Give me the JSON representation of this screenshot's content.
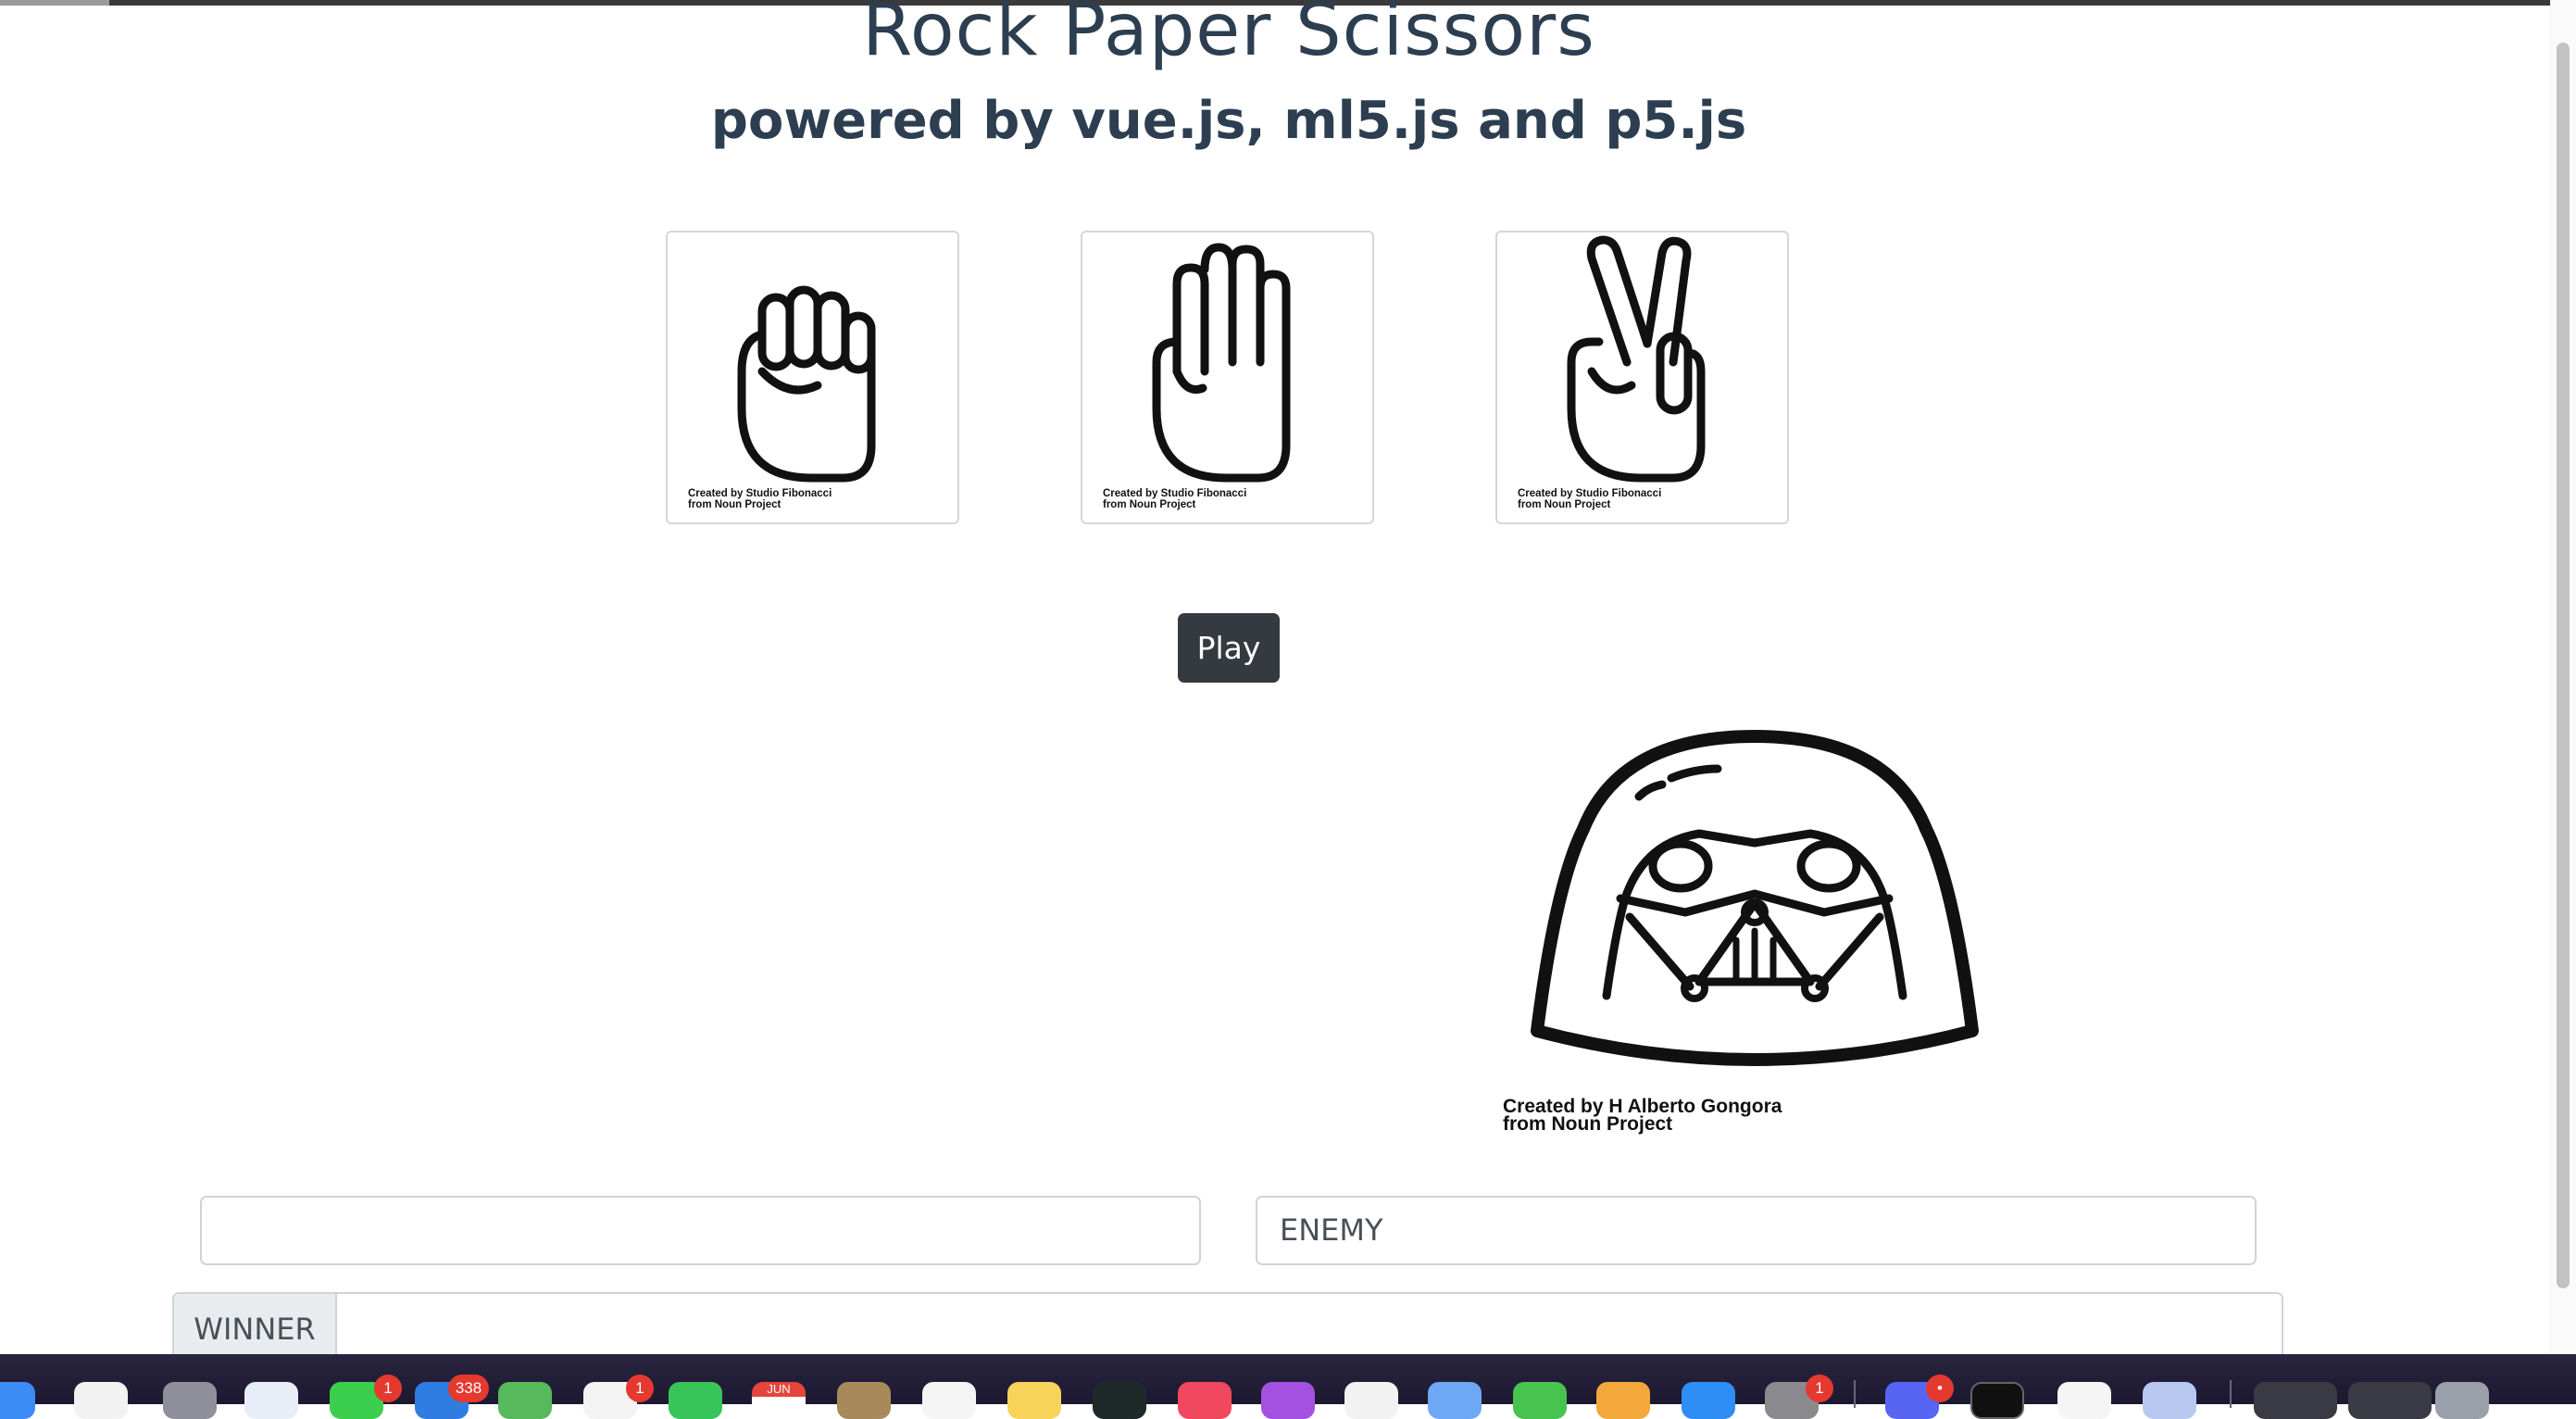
{
  "page": {
    "title": "Rock Paper Scissors",
    "subtitle": "powered by vue.js, ml5.js and p5.js"
  },
  "choices": [
    {
      "icon": "rock-fist-icon",
      "credit_line1": "Created by Studio Fibonacci",
      "credit_line2": "from Noun Project"
    },
    {
      "icon": "paper-hand-icon",
      "credit_line1": "Created by Studio Fibonacci",
      "credit_line2": "from Noun Project"
    },
    {
      "icon": "scissors-hand-icon",
      "credit_line1": "Created by Studio Fibonacci",
      "credit_line2": "from Noun Project"
    }
  ],
  "play_button": "Play",
  "enemy": {
    "icon": "darth-vader-helmet-icon",
    "credit_line1": "Created by H Alberto Gongora",
    "credit_line2": "from Noun Project"
  },
  "fields": {
    "player_value": "",
    "enemy_value": "ENEMY",
    "winner_label": "WINNER",
    "winner_value": ""
  },
  "dock": {
    "badges": {
      "messages": "1",
      "mail": "338",
      "photos": "1",
      "system_settings": "1",
      "discord": "•"
    },
    "calendar_month": "JUN"
  }
}
